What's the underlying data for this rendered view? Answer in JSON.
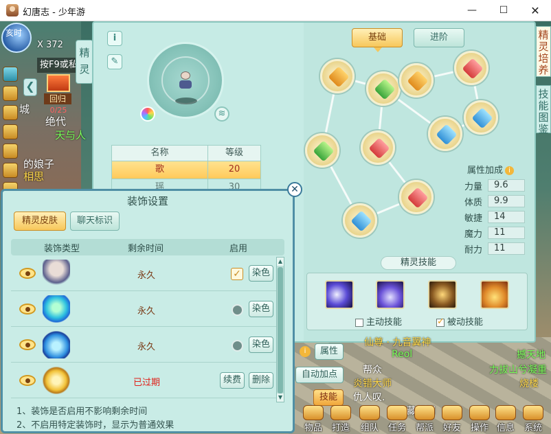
{
  "window": {
    "title": "幻唐志 - 少年游",
    "min": "—",
    "max": "☐",
    "close": "✕"
  },
  "hud": {
    "time_badge": "亥时",
    "x_count": "X 372",
    "hotkey_hint": "按F9或私",
    "return_label": "回归",
    "return_count": "0/25",
    "collapse_arrow": "❮"
  },
  "world_texts": {
    "t1": "绝代",
    "t2": "天与人",
    "t3": "的娘子",
    "t4": "相思",
    "t5": "城",
    "map1": "Reol",
    "map2": "撼天地",
    "map3": "力拔山兮凝重",
    "map4": "烧楼",
    "map5": "帮众",
    "map6": "炎错大师",
    "map7": "仇人叹.",
    "map8": "仙尊 · 九音翼神",
    "map9": "藏经阁"
  },
  "spirit_tab": "精灵",
  "spirit_panel": {
    "tool1": "i",
    "tool2": "✎",
    "name_table": {
      "col_name": "名称",
      "col_level": "等级",
      "rows": [
        {
          "name": "歌",
          "level": "20"
        },
        {
          "name": "瑶",
          "level": "30"
        }
      ]
    },
    "tabs": {
      "basic": "基础",
      "advanced": "进阶"
    },
    "attributes": {
      "title": "属性加成",
      "info": "i",
      "items": [
        {
          "label": "力量",
          "value": "9.6"
        },
        {
          "label": "体质",
          "value": "9.9"
        },
        {
          "label": "敏捷",
          "value": "14"
        },
        {
          "label": "魔力",
          "value": "11"
        },
        {
          "label": "耐力",
          "value": "11"
        }
      ]
    },
    "skills": {
      "title": "精灵技能",
      "active_label": "主动技能",
      "passive_label": "被动技能",
      "active_checked": false,
      "passive_checked": true
    }
  },
  "right_tabs": {
    "tab1": "精灵培养",
    "tab2": "技能图鉴"
  },
  "decor_dialog": {
    "close": "✕",
    "title": "装饰设置",
    "tab_skin": "精灵皮肤",
    "tab_chat": "聊天标识",
    "col_type": "装饰类型",
    "col_remain": "剩余时间",
    "col_enable": "启用",
    "rows": [
      {
        "remain": "永久",
        "btn": "染色",
        "enabled": true
      },
      {
        "remain": "永久",
        "btn": "染色",
        "enabled": false
      },
      {
        "remain": "永久",
        "btn": "染色",
        "enabled": false
      },
      {
        "remain": "已过期",
        "btn_renew": "续费",
        "btn_delete": "删除"
      }
    ],
    "note1": "1、装饰是否启用不影响剩余时间",
    "note2": "2、不启用特定装饰时，显示为普通效果"
  },
  "bottom": {
    "prop_info": "i",
    "prop_btn": "属性",
    "auto_btn": "自动加点",
    "skill_btn": "技能",
    "bar": [
      "物品",
      "打造",
      "组队",
      "任务",
      "帮派",
      "好友",
      "操作",
      "信息",
      "系统"
    ]
  },
  "colors": {
    "accent": "#f7c75a",
    "panel": "#bfe6df",
    "expired": "#e0211a",
    "permanent": "#7a3a16"
  }
}
